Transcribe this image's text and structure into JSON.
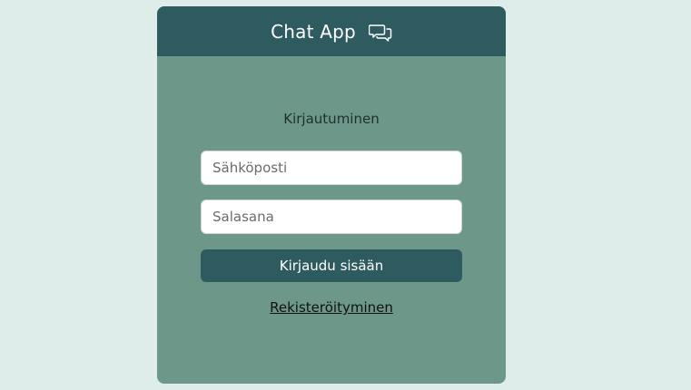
{
  "header": {
    "title": "Chat App",
    "icon": "chat-bubbles-icon"
  },
  "login": {
    "title": "Kirjautuminen",
    "email_placeholder": "Sähköposti",
    "password_placeholder": "Salasana",
    "submit_label": "Kirjaudu sisään",
    "register_link": "Rekisteröityminen"
  },
  "colors": {
    "page_bg": "#deedea",
    "card_bg": "#6c9789",
    "header_bg": "#2e5b60",
    "button_bg": "#2e5b60"
  }
}
